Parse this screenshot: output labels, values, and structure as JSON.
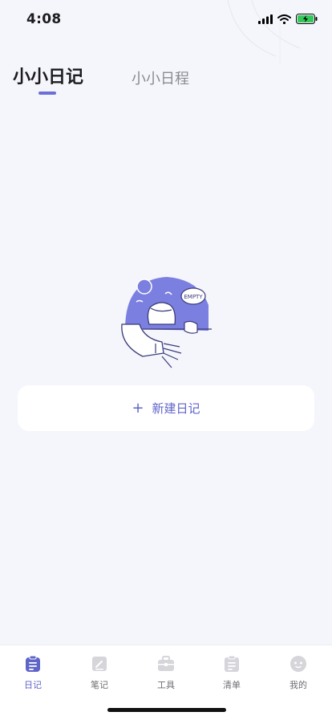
{
  "status_bar": {
    "time": "4:08",
    "icons": [
      "signal-icon",
      "wifi-icon",
      "battery-charging-icon"
    ]
  },
  "tabs": [
    {
      "label": "小小日记",
      "active": true
    },
    {
      "label": "小小日程",
      "active": false
    }
  ],
  "empty_state": {
    "badge_text": "EMPTY",
    "action_icon": "+",
    "action_label": "新建日记"
  },
  "bottom_nav": [
    {
      "label": "日记",
      "icon": "diary-icon",
      "active": true
    },
    {
      "label": "笔记",
      "icon": "note-icon",
      "active": false
    },
    {
      "label": "工具",
      "icon": "toolbox-icon",
      "active": false
    },
    {
      "label": "清单",
      "icon": "checklist-icon",
      "active": false
    },
    {
      "label": "我的",
      "icon": "profile-icon",
      "active": false
    }
  ],
  "colors": {
    "accent": "#5f64c9",
    "indicator": "#6b6fd8",
    "illustration": "#7b7fe0",
    "background": "#f5f6fb",
    "inactive_icon": "#d5d5da"
  }
}
